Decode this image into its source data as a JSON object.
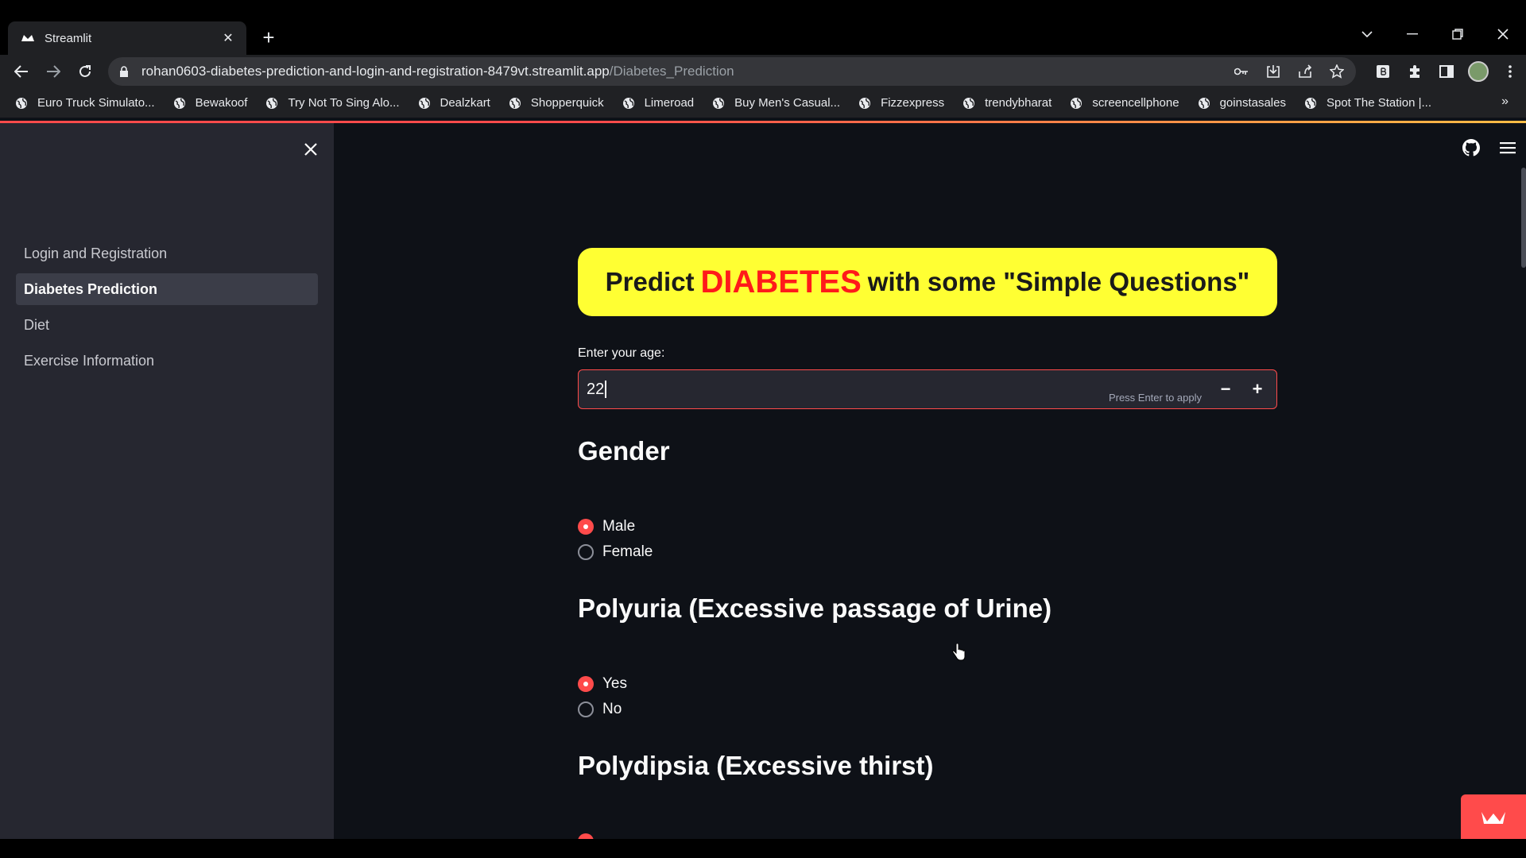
{
  "browser": {
    "tab_title": "Streamlit",
    "new_tab": "+",
    "url_host": "rohan0603-diabetes-prediction-and-login-and-registration-8479vt.streamlit.app",
    "url_path": "/Diabetes_Prediction",
    "bookmarks": [
      "Euro Truck Simulato...",
      "Bewakoof",
      "Try Not To Sing Alo...",
      "Dealzkart",
      "Shopperquick",
      "Limeroad",
      "Buy Men's Casual...",
      "Fizzexpress",
      "trendybharat",
      "screencellphone",
      "goinstasales",
      "Spot The Station |..."
    ],
    "bookmarks_more": "»"
  },
  "sidebar": {
    "items": [
      {
        "label": "Login and Registration",
        "active": false
      },
      {
        "label": "Diabetes Prediction",
        "active": true
      },
      {
        "label": "Diet",
        "active": false
      },
      {
        "label": "Exercise Information",
        "active": false
      }
    ]
  },
  "main": {
    "hero": {
      "pre": "Predict",
      "highlight": "DIABETES",
      "post": "with some \"Simple Questions\""
    },
    "age": {
      "label": "Enter your age:",
      "value": "22",
      "hint": "Press Enter to apply",
      "minus": "−",
      "plus": "+"
    },
    "sections": [
      {
        "heading": "Gender",
        "options": [
          "Male",
          "Female"
        ],
        "selected": 0
      },
      {
        "heading": "Polyuria (Excessive passage of Urine)",
        "options": [
          "Yes",
          "No"
        ],
        "selected": 0
      },
      {
        "heading": "Polydipsia (Excessive thirst)"
      }
    ]
  },
  "colors": {
    "accent": "#ff4b4b",
    "hero_bg": "#ffff33",
    "hero_highlight": "#ff1a1a",
    "sidebar_bg": "#262730",
    "main_bg": "#0e1117"
  }
}
